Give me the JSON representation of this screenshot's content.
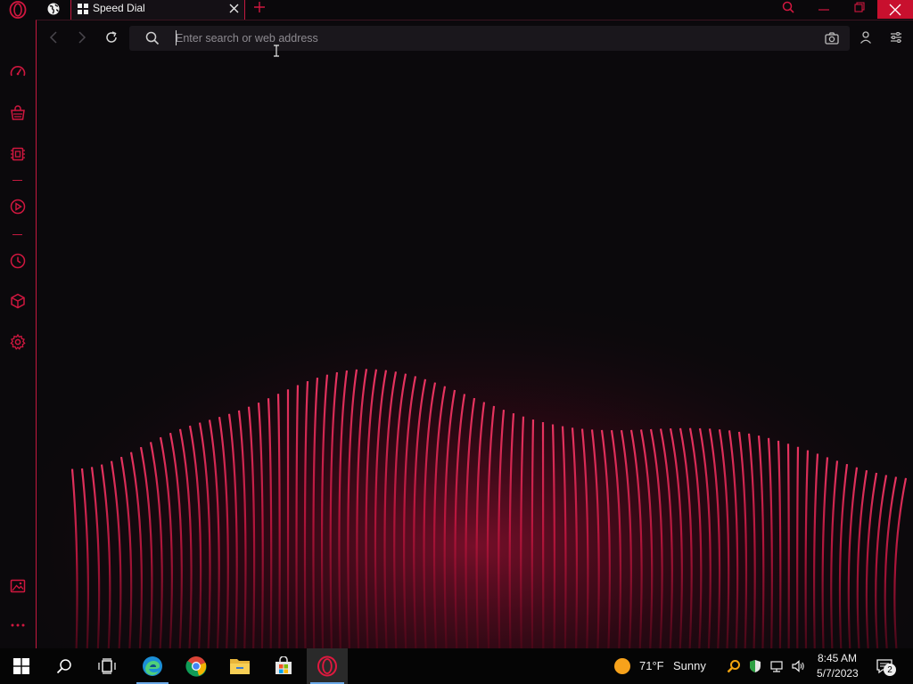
{
  "browser": {
    "tab": {
      "label": "Speed Dial"
    },
    "address_bar": {
      "placeholder": "Enter search or web address",
      "value": ""
    }
  },
  "icons": {
    "logo": "opera-logo-icon",
    "sidebar": [
      "speedometer-icon",
      "shopping-bag-icon",
      "cpu-chip-icon",
      "player-icon",
      "history-clock-icon",
      "cube-icon",
      "settings-gear-icon",
      "wallpaper-icon",
      "more-icon"
    ]
  },
  "colors": {
    "accent": "#c3193f",
    "close_button": "#c8102e",
    "background": "#0b090c",
    "taskbar": "#050505"
  },
  "taskbar": {
    "weather": {
      "temperature": "71°F",
      "condition": "Sunny"
    },
    "clock": {
      "time": "8:45 AM",
      "date": "5/7/2023"
    },
    "notifications": {
      "count": "2"
    }
  }
}
